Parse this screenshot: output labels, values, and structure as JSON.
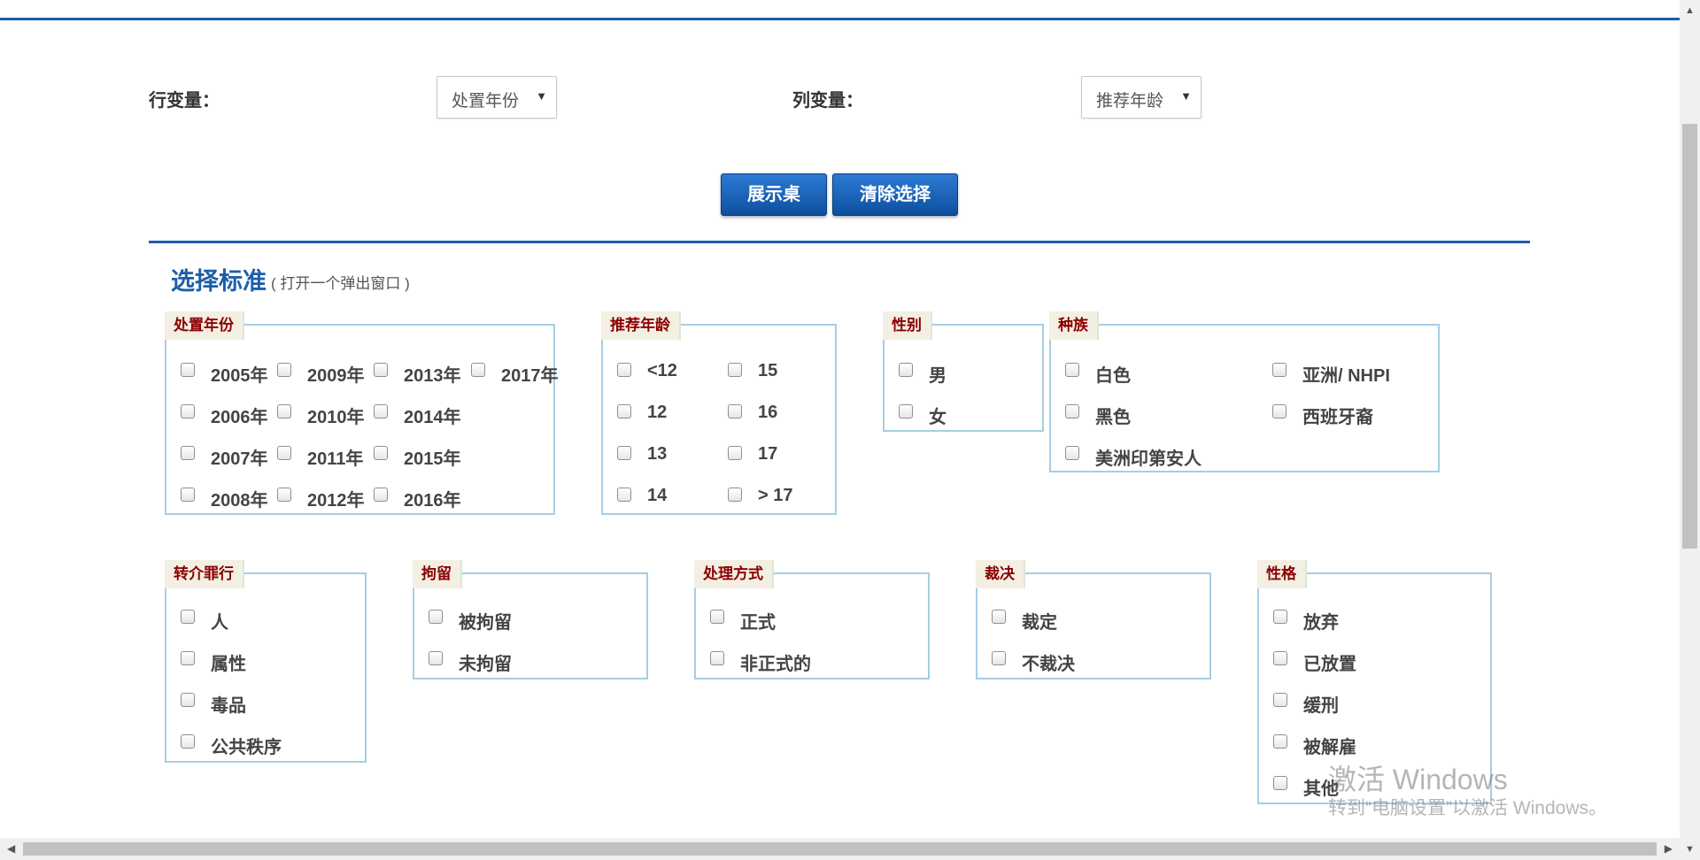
{
  "header": {
    "row_variable_label": "行变量：",
    "row_variable_value": "处置年份",
    "column_variable_label": "列变量：",
    "column_variable_value": "推荐年龄",
    "dropdown_arrow_icon": "triangle-down-icon"
  },
  "buttons": {
    "show_table": "展示桌",
    "clear_selection": "清除选择"
  },
  "criteria": {
    "title": "选择标准",
    "subtitle": "( 打开一个弹出窗口 )"
  },
  "groups": {
    "disposition_year": {
      "legend": "处置年份",
      "options": [
        "2005年",
        "2009年",
        "2013年",
        "2017年",
        "2006年",
        "2010年",
        "2014年",
        "2007年",
        "2011年",
        "2015年",
        "2008年",
        "2012年",
        "2016年"
      ]
    },
    "referral_age": {
      "legend": "推荐年龄",
      "options": [
        "<12",
        "15",
        "12",
        "16",
        "13",
        "17",
        "14",
        "> 17"
      ]
    },
    "gender": {
      "legend": "性别",
      "options": [
        "男",
        "女"
      ]
    },
    "race": {
      "legend": "种族",
      "options": [
        "白色",
        "亚洲/ NHPI",
        "黑色",
        "西班牙裔",
        "美洲印第安人"
      ]
    },
    "referral_offense": {
      "legend": "转介罪行",
      "options": [
        "人",
        "属性",
        "毒品",
        "公共秩序"
      ]
    },
    "detention": {
      "legend": "拘留",
      "options": [
        "被拘留",
        "未拘留"
      ]
    },
    "handling": {
      "legend": "处理方式",
      "options": [
        "正式",
        "非正式的"
      ]
    },
    "adjudication": {
      "legend": "裁决",
      "options": [
        "裁定",
        "不裁决"
      ]
    },
    "disposition": {
      "legend": "性格",
      "options": [
        "放弃",
        "已放置",
        "缓刑",
        "被解雇",
        "其他"
      ]
    }
  },
  "watermark": {
    "line1": "激活 Windows",
    "line2": "转到“电脑设置”以激活 Windows。"
  },
  "scrollbars": {
    "up_icon": "arrow-up-icon",
    "down_icon": "arrow-down-icon",
    "left_icon": "arrow-left-icon",
    "right_icon": "arrow-right-icon"
  }
}
